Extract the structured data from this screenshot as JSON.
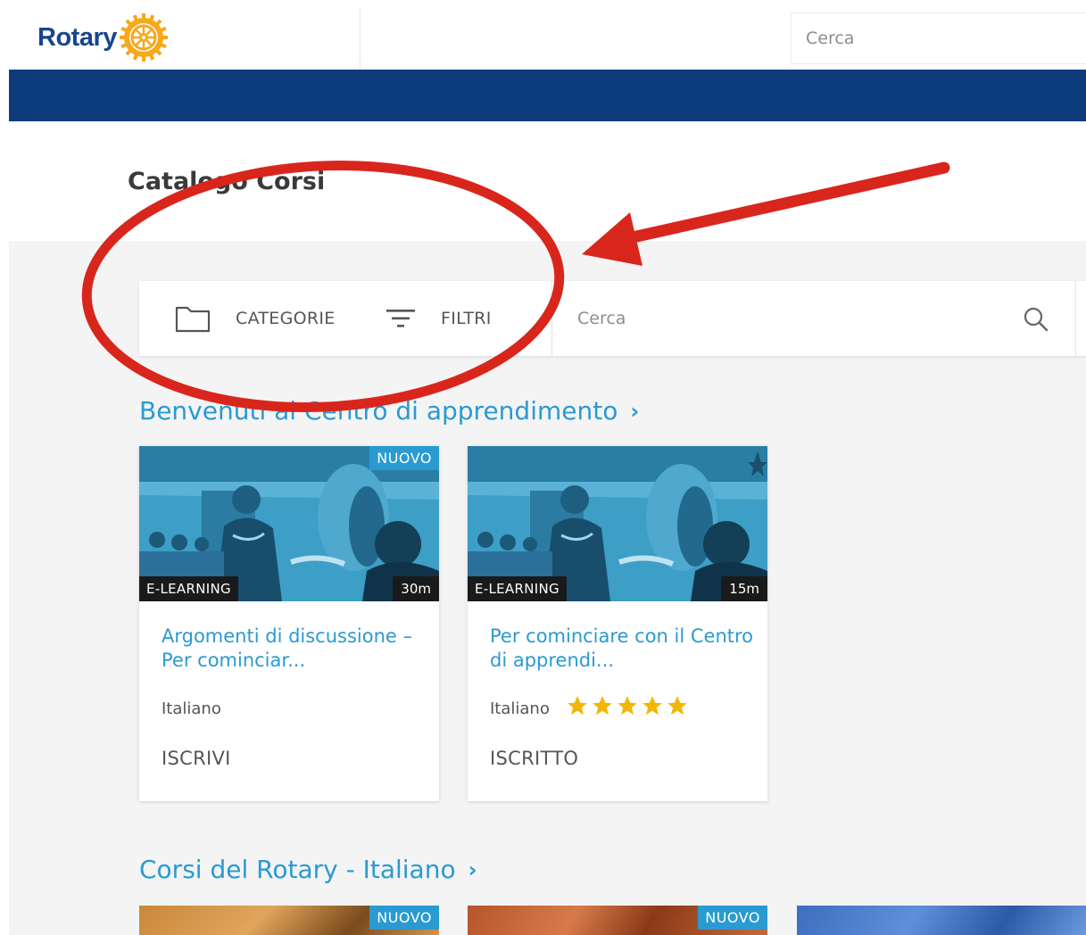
{
  "header": {
    "logo_text": "Rotary",
    "search_placeholder": "Cerca"
  },
  "page": {
    "title": "Catalogo Corsi"
  },
  "filterbar": {
    "categories_label": "CATEGORIE",
    "filters_label": "FILTRI",
    "search_placeholder": "Cerca"
  },
  "sections": [
    {
      "title": "Benvenuti al Centro di apprendimento",
      "cards": [
        {
          "badge_new": "NUOVO",
          "type": "E-LEARNING",
          "duration": "30m",
          "title": "Argomenti di discussione – Per cominciar...",
          "language": "Italiano",
          "rating": 0,
          "action": "ISCRIVI"
        },
        {
          "badge_new": "",
          "type": "E-LEARNING",
          "duration": "15m",
          "title": "Per cominciare con il Centro di apprendi...",
          "language": "Italiano",
          "rating": 5,
          "action": "ISCRITTO"
        }
      ]
    },
    {
      "title": "Corsi del Rotary - Italiano",
      "cards": [
        {
          "badge_new": "NUOVO"
        },
        {
          "badge_new": "NUOVO"
        },
        {
          "badge_new": ""
        }
      ]
    }
  ],
  "chevron": "›",
  "colors": {
    "brand_blue": "#17458f",
    "nav_blue": "#0c3c7c",
    "link_blue": "#2a9ad2",
    "star_gold": "#f2b705",
    "annotation_red": "#d9261c"
  },
  "icons": [
    "rotary-wheel-icon",
    "folder-icon",
    "filter-icon",
    "search-icon",
    "star-icon",
    "chevron-right-icon"
  ]
}
